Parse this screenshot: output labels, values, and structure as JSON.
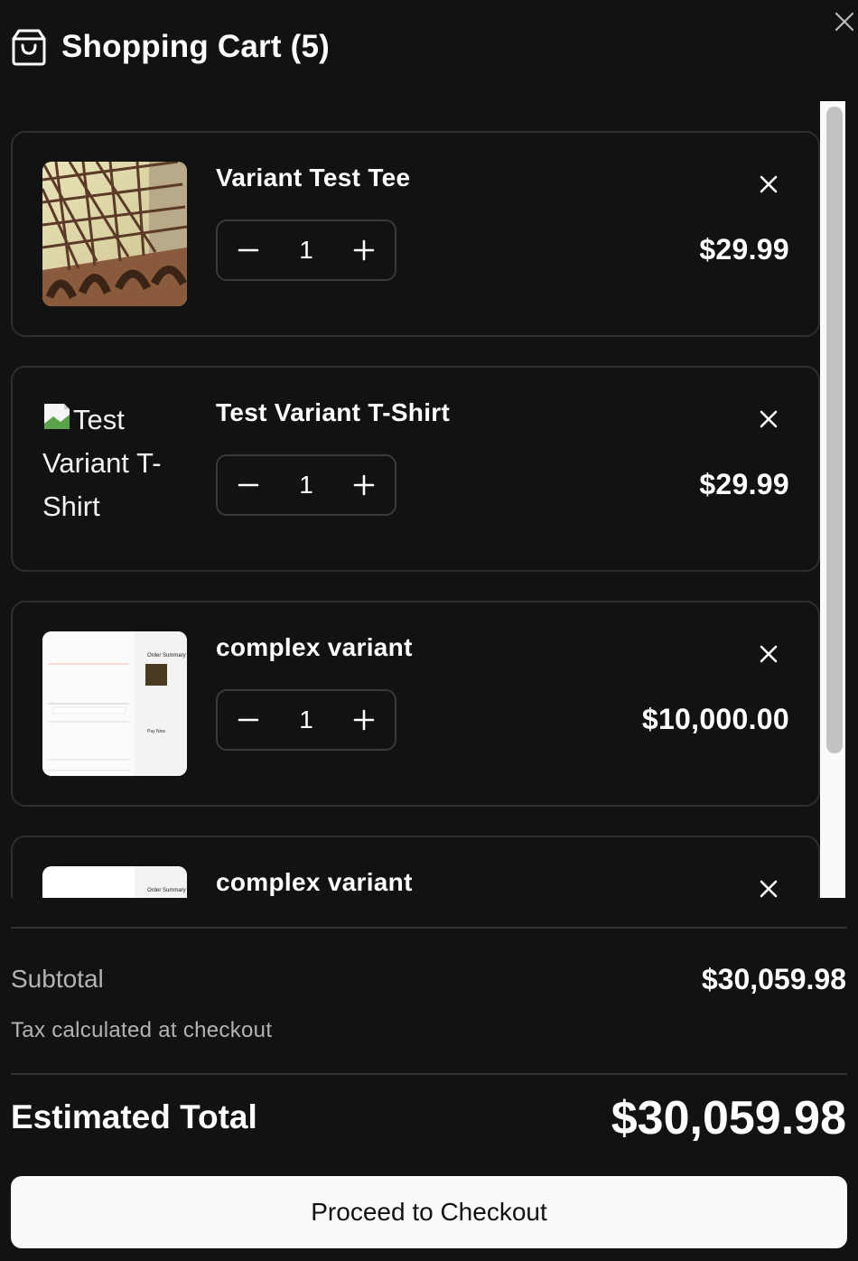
{
  "header": {
    "title": "Shopping Cart (5)",
    "icon": "shopping-bag-icon"
  },
  "items": [
    {
      "title": "Variant Test Tee",
      "quantity": "1",
      "price": "$29.99",
      "image": "photo"
    },
    {
      "title": "Test Variant T-Shirt",
      "quantity": "1",
      "price": "$29.99",
      "image_alt": "Test Variant T-Shirt"
    },
    {
      "title": "complex variant",
      "quantity": "1",
      "price": "$10,000.00",
      "image": "screenshot"
    },
    {
      "title": "complex variant",
      "image": "screenshot"
    }
  ],
  "thumbnail_text": {
    "order_summary": "Order Summary",
    "pay_now": "Pay Now"
  },
  "summary": {
    "subtotal_label": "Subtotal",
    "subtotal_value": "$30,059.98",
    "tax_note": "Tax calculated at checkout",
    "estimated_label": "Estimated Total",
    "estimated_value": "$30,059.98"
  },
  "checkout_label": "Proceed to Checkout",
  "colors": {
    "background": "#121212",
    "border": "#2e2e2e",
    "button_bg": "#fafafa",
    "muted_text": "#b3b3b3"
  }
}
